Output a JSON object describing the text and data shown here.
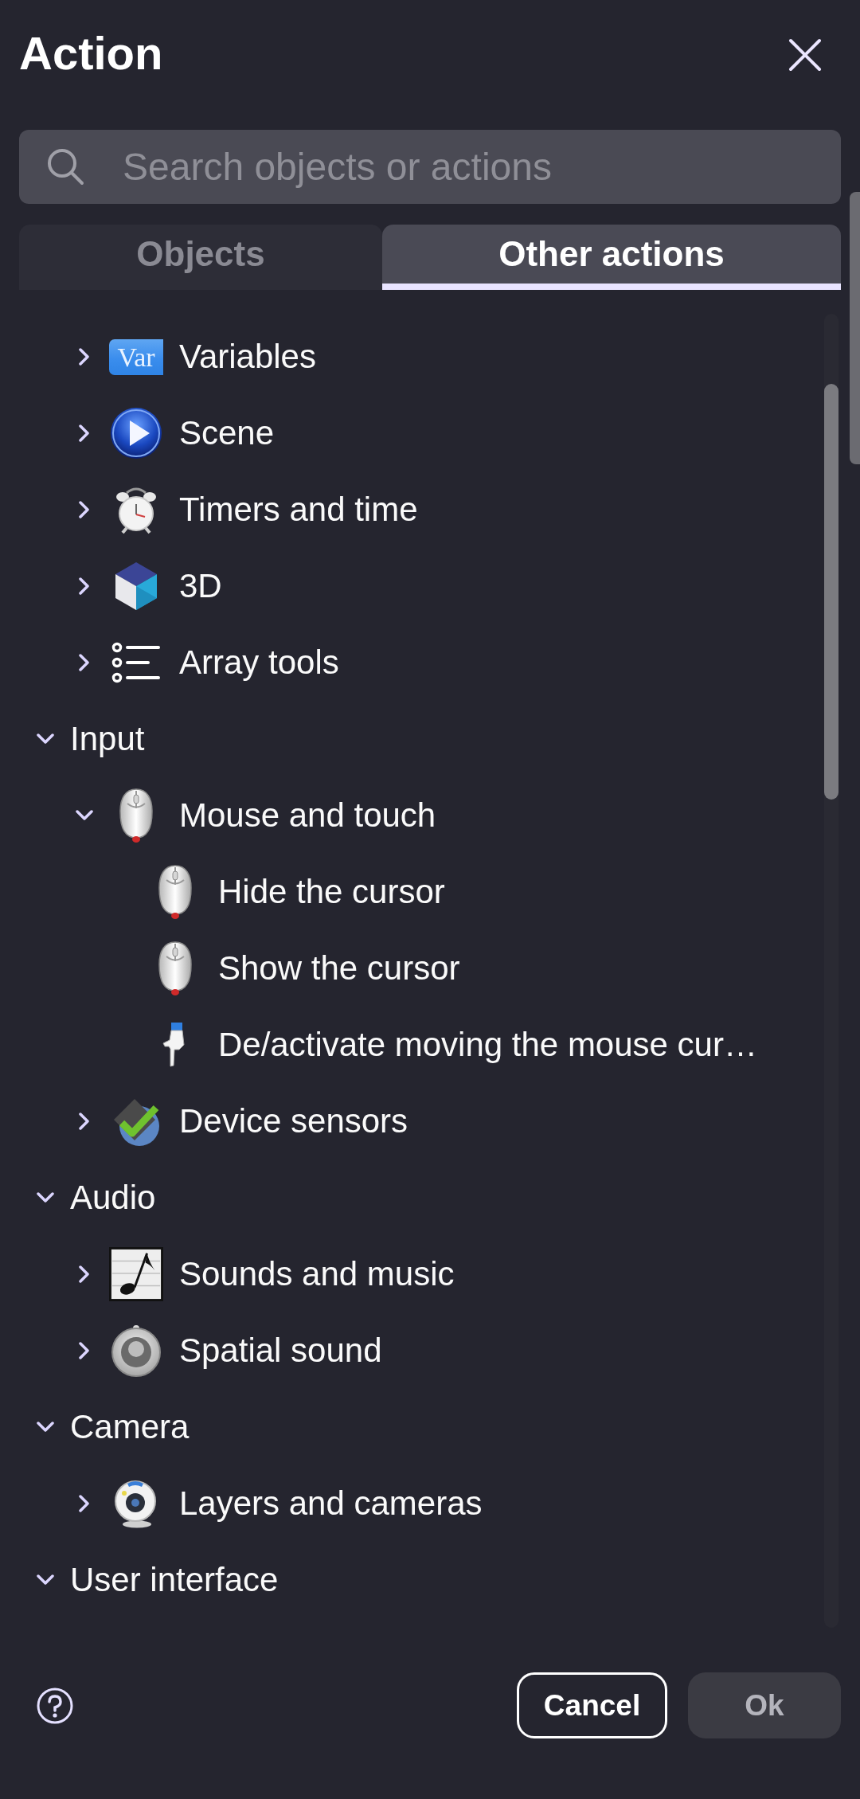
{
  "dialog": {
    "title": "Action"
  },
  "search": {
    "placeholder": "Search objects or actions"
  },
  "tabs": [
    {
      "label": "Objects",
      "selected": false
    },
    {
      "label": "Other actions",
      "selected": true
    }
  ],
  "tree": [
    {
      "children": [
        {
          "label": "Variables",
          "kind": "var",
          "icon_text": "Var",
          "expanded": false
        },
        {
          "label": "Scene",
          "kind": "play",
          "expanded": false
        },
        {
          "label": "Timers and time",
          "kind": "clock",
          "expanded": false
        },
        {
          "label": "3D",
          "kind": "cube",
          "expanded": false
        },
        {
          "label": "Array tools",
          "kind": "list",
          "expanded": false
        }
      ]
    },
    {
      "label": "Input",
      "expanded": true,
      "children": [
        {
          "label": "Mouse and touch",
          "kind": "mouse",
          "expanded": true,
          "children": [
            {
              "label": "Hide the cursor",
              "kind": "mouse"
            },
            {
              "label": "Show the cursor",
              "kind": "mouse"
            },
            {
              "label": "De/activate moving the mouse cur…",
              "kind": "pointer"
            }
          ]
        },
        {
          "label": "Device sensors",
          "kind": "sensor",
          "expanded": false
        }
      ]
    },
    {
      "label": "Audio",
      "expanded": true,
      "children": [
        {
          "label": "Sounds and music",
          "kind": "note",
          "expanded": false
        },
        {
          "label": "Spatial sound",
          "kind": "speaker",
          "expanded": false
        }
      ]
    },
    {
      "label": "Camera",
      "expanded": true,
      "children": [
        {
          "label": "Layers and cameras",
          "kind": "webcam",
          "expanded": false
        }
      ]
    },
    {
      "label": "User interface",
      "expanded": true
    }
  ],
  "footer": {
    "buttons": [
      {
        "label": "Cancel",
        "kind": "secondary",
        "disabled": false
      },
      {
        "label": "Ok",
        "kind": "primary",
        "disabled": true
      }
    ]
  }
}
